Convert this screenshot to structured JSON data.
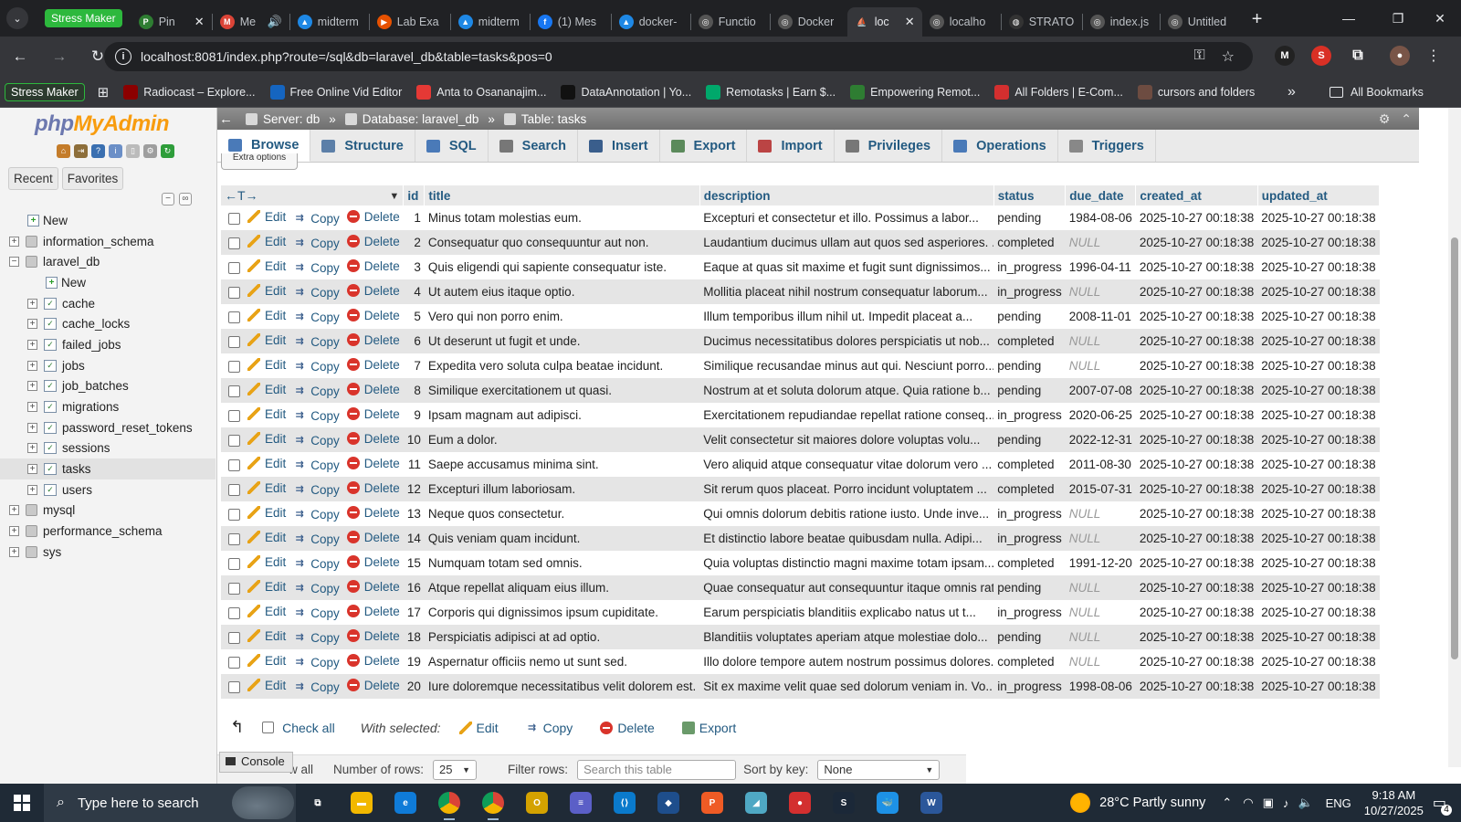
{
  "browser": {
    "tab_group_label": "Stress Maker",
    "tabs": [
      {
        "title": "Pin",
        "color": "#2e7d32",
        "glyph": "P",
        "close": "✕"
      },
      {
        "title": "Me",
        "color": "#db4437",
        "glyph": "M",
        "audio": "🔊"
      },
      {
        "title": "midterm",
        "color": "#1e88e5",
        "glyph": "▲"
      },
      {
        "title": "Lab Exa",
        "color": "#e65100",
        "glyph": "▶"
      },
      {
        "title": "midterm",
        "color": "#1e88e5",
        "glyph": "▲"
      },
      {
        "title": "(1) Mes",
        "color": "#1877f2",
        "glyph": "f"
      },
      {
        "title": "docker-",
        "color": "#1e88e5",
        "glyph": "▲"
      },
      {
        "title": "Functio",
        "color": "#555",
        "glyph": "◎"
      },
      {
        "title": "Docker",
        "color": "#555",
        "glyph": "◎"
      },
      {
        "title": "loc",
        "color": "#f89c0e",
        "glyph": "pma",
        "close": "✕",
        "active": true
      },
      {
        "title": "localho",
        "color": "#555",
        "glyph": "◎"
      },
      {
        "title": "STRATO",
        "color": "#333",
        "glyph": "◍"
      },
      {
        "title": "index.js",
        "color": "#555",
        "glyph": "◎"
      },
      {
        "title": "Untitled",
        "color": "#555",
        "glyph": "◎"
      }
    ],
    "new_tab_icon": "+",
    "url": "localhost:8081/index.php?route=/sql&db=laravel_db&table=tasks&pos=0",
    "bookmarks_group": "Stress Maker",
    "bookmarks": [
      {
        "label": "Radiocast – Explore...",
        "color": "#8b0000"
      },
      {
        "label": "Free Online Vid Editor",
        "color": "#1565c0"
      },
      {
        "label": "Anta to Osananajim...",
        "color": "#e53935"
      },
      {
        "label": "DataAnnotation | Yo...",
        "color": "#111"
      },
      {
        "label": "Remotasks | Earn $...",
        "color": "#00a86b"
      },
      {
        "label": "Empowering Remot...",
        "color": "#2e7d32"
      },
      {
        "label": "All Folders | E-Com...",
        "color": "#d32f2f"
      },
      {
        "label": "cursors and folders",
        "color": "#6d4c41"
      }
    ],
    "all_bookmarks": "All Bookmarks"
  },
  "nav": {
    "logo_php": "php",
    "logo_myadmin": "MyAdmin",
    "recent": "Recent",
    "favorites": "Favorites",
    "tree_top": [
      {
        "label": "New",
        "kind": "new"
      },
      {
        "label": "information_schema",
        "kind": "db"
      },
      {
        "label": "laravel_db",
        "kind": "db",
        "open": true
      }
    ],
    "laravel_tables": [
      {
        "label": "New",
        "kind": "new"
      },
      {
        "label": "cache",
        "kind": "table"
      },
      {
        "label": "cache_locks",
        "kind": "table"
      },
      {
        "label": "failed_jobs",
        "kind": "table"
      },
      {
        "label": "jobs",
        "kind": "table"
      },
      {
        "label": "job_batches",
        "kind": "table"
      },
      {
        "label": "migrations",
        "kind": "table"
      },
      {
        "label": "password_reset_tokens",
        "kind": "table"
      },
      {
        "label": "sessions",
        "kind": "table"
      },
      {
        "label": "tasks",
        "kind": "table",
        "selected": true
      },
      {
        "label": "users",
        "kind": "table"
      }
    ],
    "tree_bottom": [
      {
        "label": "mysql",
        "kind": "db"
      },
      {
        "label": "performance_schema",
        "kind": "db"
      },
      {
        "label": "sys",
        "kind": "db"
      }
    ]
  },
  "breadcrumb": {
    "server": "Server: db",
    "database": "Database: laravel_db",
    "table": "Table: tasks"
  },
  "menu": [
    {
      "label": "Browse",
      "color": "#4a7ab8",
      "active": true
    },
    {
      "label": "Structure",
      "color": "#5c7fa8"
    },
    {
      "label": "SQL",
      "color": "#4a7ab8"
    },
    {
      "label": "Search",
      "color": "#777"
    },
    {
      "label": "Insert",
      "color": "#3a5e8c"
    },
    {
      "label": "Export",
      "color": "#5b8a5b"
    },
    {
      "label": "Import",
      "color": "#b44"
    },
    {
      "label": "Privileges",
      "color": "#777"
    },
    {
      "label": "Operations",
      "color": "#4a7ab8"
    },
    {
      "label": "Triggers",
      "color": "#888"
    }
  ],
  "extra_options": "Extra options",
  "table": {
    "columns": [
      "id",
      "title",
      "description",
      "status",
      "due_date",
      "created_at",
      "updated_at"
    ],
    "actions": {
      "edit": "Edit",
      "copy": "Copy",
      "delete": "Delete"
    },
    "rows": [
      {
        "id": "1",
        "title": "Minus totam molestias eum.",
        "description": "Excepturi et consectetur et illo. Possimus a labor...",
        "status": "pending",
        "due_date": "1984-08-06",
        "created_at": "2025-10-27 00:18:38",
        "updated_at": "2025-10-27 00:18:38"
      },
      {
        "id": "2",
        "title": "Consequatur quo consequuntur aut non.",
        "description": "Laudantium ducimus ullam aut quos sed asperiores. ...",
        "status": "completed",
        "due_date": "NULL",
        "created_at": "2025-10-27 00:18:38",
        "updated_at": "2025-10-27 00:18:38"
      },
      {
        "id": "3",
        "title": "Quis eligendi qui sapiente consequatur iste.",
        "description": "Eaque at quas sit maxime et fugit sunt dignissimos...",
        "status": "in_progress",
        "due_date": "1996-04-11",
        "created_at": "2025-10-27 00:18:38",
        "updated_at": "2025-10-27 00:18:38"
      },
      {
        "id": "4",
        "title": "Ut autem eius itaque optio.",
        "description": "Mollitia placeat nihil nostrum consequatur laborum...",
        "status": "in_progress",
        "due_date": "NULL",
        "created_at": "2025-10-27 00:18:38",
        "updated_at": "2025-10-27 00:18:38"
      },
      {
        "id": "5",
        "title": "Vero qui non porro enim.",
        "description": "Illum temporibus illum nihil ut. Impedit placeat a...",
        "status": "pending",
        "due_date": "2008-11-01",
        "created_at": "2025-10-27 00:18:38",
        "updated_at": "2025-10-27 00:18:38"
      },
      {
        "id": "6",
        "title": "Ut deserunt ut fugit et unde.",
        "description": "Ducimus necessitatibus dolores perspiciatis ut nob...",
        "status": "completed",
        "due_date": "NULL",
        "created_at": "2025-10-27 00:18:38",
        "updated_at": "2025-10-27 00:18:38"
      },
      {
        "id": "7",
        "title": "Expedita vero soluta culpa beatae incidunt.",
        "description": "Similique recusandae minus aut qui. Nesciunt porro...",
        "status": "pending",
        "due_date": "NULL",
        "created_at": "2025-10-27 00:18:38",
        "updated_at": "2025-10-27 00:18:38"
      },
      {
        "id": "8",
        "title": "Similique exercitationem ut quasi.",
        "description": "Nostrum at et soluta dolorum atque. Quia ratione b...",
        "status": "pending",
        "due_date": "2007-07-08",
        "created_at": "2025-10-27 00:18:38",
        "updated_at": "2025-10-27 00:18:38"
      },
      {
        "id": "9",
        "title": "Ipsam magnam aut adipisci.",
        "description": "Exercitationem repudiandae repellat ratione conseq...",
        "status": "in_progress",
        "due_date": "2020-06-25",
        "created_at": "2025-10-27 00:18:38",
        "updated_at": "2025-10-27 00:18:38"
      },
      {
        "id": "10",
        "title": "Eum a dolor.",
        "description": "Velit consectetur sit maiores dolore voluptas volu...",
        "status": "pending",
        "due_date": "2022-12-31",
        "created_at": "2025-10-27 00:18:38",
        "updated_at": "2025-10-27 00:18:38"
      },
      {
        "id": "11",
        "title": "Saepe accusamus minima sint.",
        "description": "Vero aliquid atque consequatur vitae dolorum vero ...",
        "status": "completed",
        "due_date": "2011-08-30",
        "created_at": "2025-10-27 00:18:38",
        "updated_at": "2025-10-27 00:18:38"
      },
      {
        "id": "12",
        "title": "Excepturi illum laboriosam.",
        "description": "Sit rerum quos placeat. Porro incidunt voluptatem ...",
        "status": "completed",
        "due_date": "2015-07-31",
        "created_at": "2025-10-27 00:18:38",
        "updated_at": "2025-10-27 00:18:38"
      },
      {
        "id": "13",
        "title": "Neque quos consectetur.",
        "description": "Qui omnis dolorum debitis ratione iusto. Unde inve...",
        "status": "in_progress",
        "due_date": "NULL",
        "created_at": "2025-10-27 00:18:38",
        "updated_at": "2025-10-27 00:18:38"
      },
      {
        "id": "14",
        "title": "Quis veniam quam incidunt.",
        "description": "Et distinctio labore beatae quibusdam nulla. Adipi...",
        "status": "in_progress",
        "due_date": "NULL",
        "created_at": "2025-10-27 00:18:38",
        "updated_at": "2025-10-27 00:18:38"
      },
      {
        "id": "15",
        "title": "Numquam totam sed omnis.",
        "description": "Quia voluptas distinctio magni maxime totam ipsam....",
        "status": "completed",
        "due_date": "1991-12-20",
        "created_at": "2025-10-27 00:18:38",
        "updated_at": "2025-10-27 00:18:38"
      },
      {
        "id": "16",
        "title": "Atque repellat aliquam eius illum.",
        "description": "Quae consequatur aut consequuntur itaque omnis rat...",
        "status": "pending",
        "due_date": "NULL",
        "created_at": "2025-10-27 00:18:38",
        "updated_at": "2025-10-27 00:18:38"
      },
      {
        "id": "17",
        "title": "Corporis qui dignissimos ipsum cupiditate.",
        "description": "Earum perspiciatis blanditiis explicabo natus ut t...",
        "status": "in_progress",
        "due_date": "NULL",
        "created_at": "2025-10-27 00:18:38",
        "updated_at": "2025-10-27 00:18:38"
      },
      {
        "id": "18",
        "title": "Perspiciatis adipisci at ad optio.",
        "description": "Blanditiis voluptates aperiam atque molestiae dolo...",
        "status": "pending",
        "due_date": "NULL",
        "created_at": "2025-10-27 00:18:38",
        "updated_at": "2025-10-27 00:18:38"
      },
      {
        "id": "19",
        "title": "Aspernatur officiis nemo ut sunt sed.",
        "description": "Illo dolore tempore autem nostrum possimus dolores...",
        "status": "completed",
        "due_date": "NULL",
        "created_at": "2025-10-27 00:18:38",
        "updated_at": "2025-10-27 00:18:38"
      },
      {
        "id": "20",
        "title": "Iure doloremque necessitatibus velit dolorem est.",
        "description": "Sit ex maxime velit quae sed dolorum veniam in. Vo...",
        "status": "in_progress",
        "due_date": "1998-08-06",
        "created_at": "2025-10-27 00:18:38",
        "updated_at": "2025-10-27 00:18:38"
      }
    ]
  },
  "bulk": {
    "check_all": "Check all",
    "with_selected": "With selected:",
    "edit": "Edit",
    "copy": "Copy",
    "delete": "Delete",
    "export": "Export"
  },
  "bottom_nav": {
    "show_all": "w all",
    "number_of_rows_label": "Number of rows:",
    "number_of_rows_value": "25",
    "filter_label": "Filter rows:",
    "filter_placeholder": "Search this table",
    "sort_label": "Sort by key:",
    "sort_value": "None"
  },
  "console_label": "Console",
  "taskbar": {
    "search_placeholder": "Type here to search",
    "apps": [
      {
        "name": "task-view",
        "color": "transparent",
        "glyph": "⧉"
      },
      {
        "name": "file-explorer",
        "color": "#f2b800",
        "glyph": "▬"
      },
      {
        "name": "edge",
        "color": "#0f7bd8",
        "glyph": "e"
      },
      {
        "name": "chrome",
        "color": "#db4437",
        "glyph": "◉",
        "open": true
      },
      {
        "name": "chrome-alt",
        "color": "#c0392b",
        "glyph": "◉",
        "open": true
      },
      {
        "name": "opera",
        "color": "#d4a200",
        "glyph": "O"
      },
      {
        "name": "app-stripe",
        "color": "#5b5fc7",
        "glyph": "≡"
      },
      {
        "name": "vscode",
        "color": "#0a7acc",
        "glyph": "⟨⟩"
      },
      {
        "name": "app-blue",
        "color": "#1e4e8c",
        "glyph": "◆"
      },
      {
        "name": "postman",
        "color": "#ef5b25",
        "glyph": "P"
      },
      {
        "name": "app-cyan",
        "color": "#4fa8c4",
        "glyph": "◢"
      },
      {
        "name": "app-red",
        "color": "#d32f2f",
        "glyph": "●"
      },
      {
        "name": "steam",
        "color": "#1b2838",
        "glyph": "S"
      },
      {
        "name": "docker",
        "color": "#1d91e6",
        "glyph": "🐳"
      },
      {
        "name": "word",
        "color": "#2b579a",
        "glyph": "W"
      }
    ],
    "weather": "28°C  Partly sunny",
    "lang": "ENG",
    "time": "9:18 AM",
    "date": "10/27/2025",
    "notification_count": "4"
  }
}
